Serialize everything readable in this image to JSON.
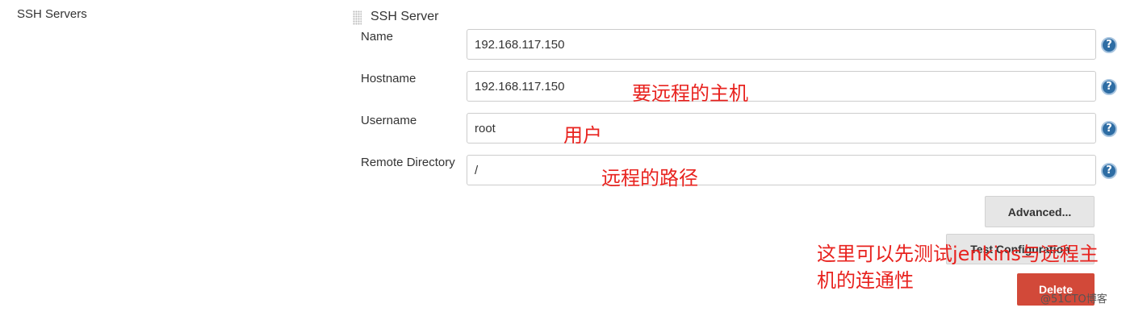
{
  "section": {
    "label": "SSH Servers"
  },
  "block": {
    "title": "SSH Server"
  },
  "fields": [
    {
      "label": "Name",
      "value": "192.168.117.150",
      "help": "?"
    },
    {
      "label": "Hostname",
      "value": "192.168.117.150",
      "help": "?"
    },
    {
      "label": "Username",
      "value": "root",
      "help": "?"
    },
    {
      "label": "Remote Directory",
      "value": "/",
      "help": "?"
    }
  ],
  "buttons": {
    "advanced": "Advanced...",
    "test": "Test Configuration",
    "delete": "Delete"
  },
  "annotations": {
    "hostname": "要远程的主机",
    "username": "用户",
    "remote_dir": "远程的路径",
    "test": "这里可以先测试jenkins与远程主机的连通性"
  },
  "watermark": "@51CTO博客",
  "icons": {
    "drag": "drag-handle-icon",
    "help": "help-icon"
  },
  "colors": {
    "annotation": "#e8231f",
    "delete_button": "#d24939",
    "help_icon": "#2e6da4"
  }
}
